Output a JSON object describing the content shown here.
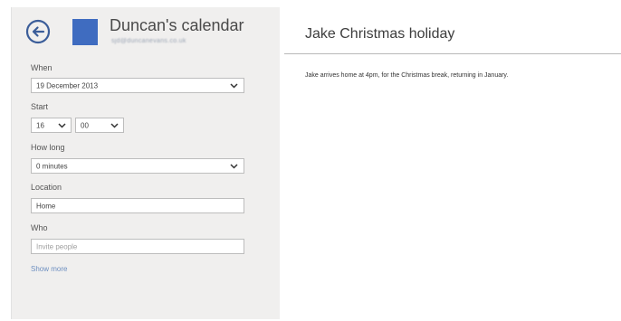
{
  "header": {
    "back_icon": "back-arrow-circle-icon",
    "calendar_name": "Duncan's calendar",
    "calendar_email": "sjd@duncanevans.co.uk",
    "calendar_color": "#3f6cc0"
  },
  "form": {
    "when": {
      "label": "When",
      "value": "19 December 2013"
    },
    "start": {
      "label": "Start",
      "hour": "16",
      "minute": "00"
    },
    "how_long": {
      "label": "How long",
      "value": "0 minutes"
    },
    "location": {
      "label": "Location",
      "value": "Home"
    },
    "who": {
      "label": "Who",
      "placeholder": "Invite people"
    },
    "show_more": "Show more"
  },
  "event": {
    "title": "Jake Christmas holiday",
    "notes": "Jake arrives home at 4pm, for the Christmas break, returning in January."
  }
}
